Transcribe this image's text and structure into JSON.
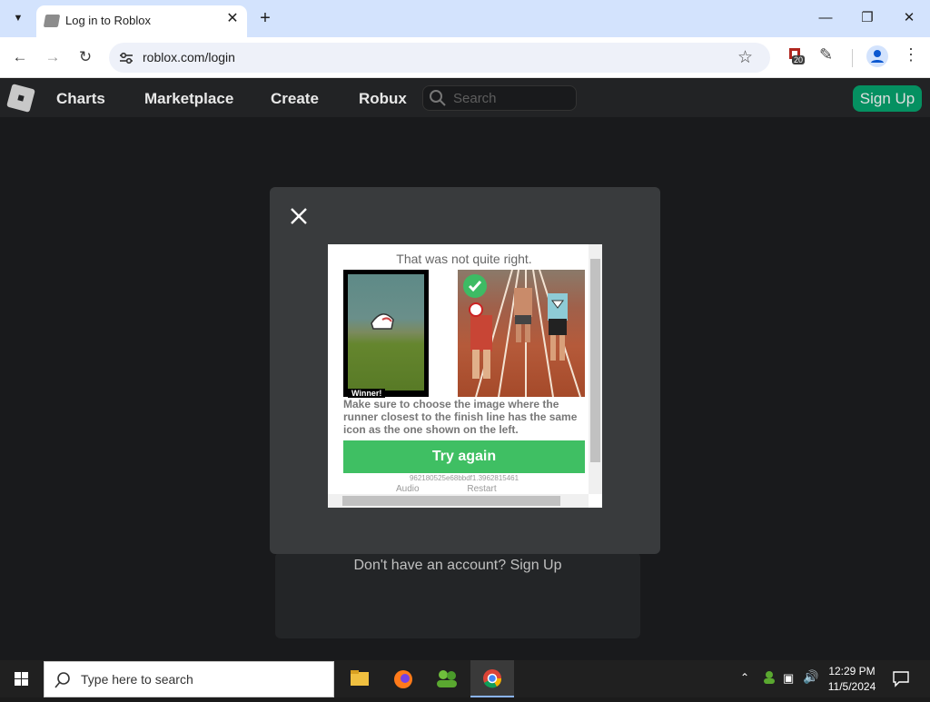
{
  "browser": {
    "tab_title": "Log in to Roblox",
    "url": "roblox.com/login",
    "extension_badge": "20"
  },
  "roblox": {
    "nav": [
      "Charts",
      "Marketplace",
      "Create",
      "Robux"
    ],
    "search_placeholder": "Search",
    "signup_label": "Sign Up",
    "no_account_text": "Don't have an account? Sign Up"
  },
  "captcha": {
    "header": "That was not quite right.",
    "reference_label": "Winner!",
    "instruction": "Make sure to choose the image where the runner closest to the finish line has the same icon as the one shown on the left.",
    "try_again_label": "Try again",
    "session_id": "962180525e68bbdf1.3962815461",
    "links": [
      "Audio",
      "Restart"
    ]
  },
  "taskbar": {
    "search_placeholder": "Type here to search",
    "time": "12:29 PM",
    "date": "11/5/2024"
  },
  "colors": {
    "accent_green": "#3fbf63",
    "roblox_header": "#222325",
    "tab_strip": "#d3e3fd"
  }
}
